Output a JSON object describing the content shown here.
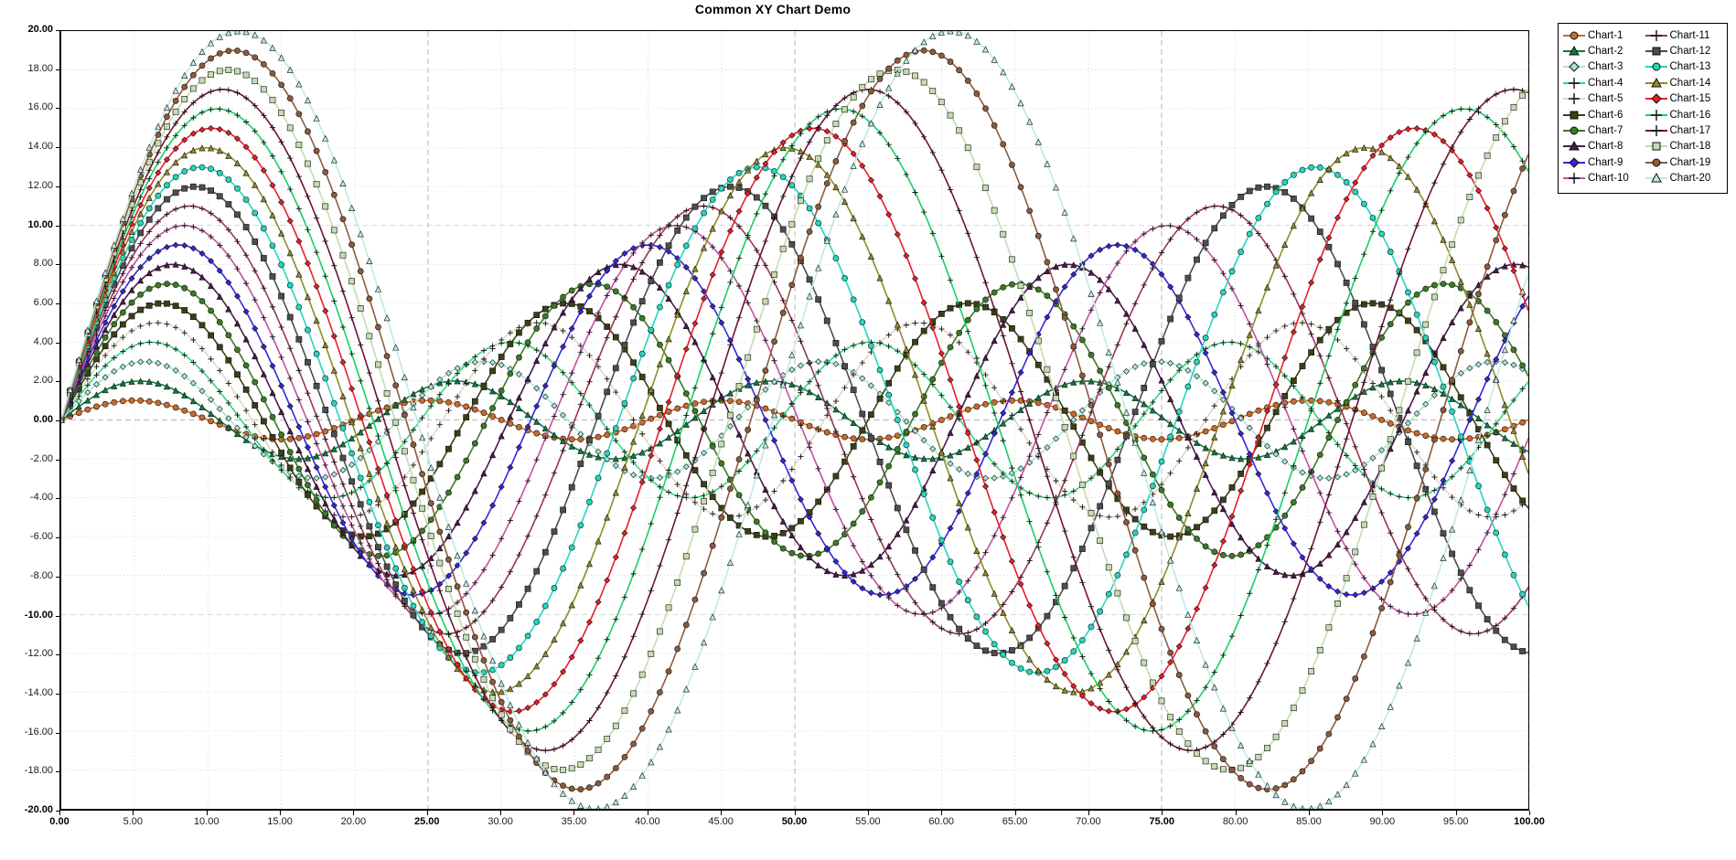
{
  "title": "Common XY Chart Demo",
  "axes": {
    "x": {
      "label": "",
      "min": 0,
      "max": 100,
      "step": 5,
      "ticks": [
        "0.00",
        "5.00",
        "10.00",
        "15.00",
        "20.00",
        "25.00",
        "30.00",
        "35.00",
        "40.00",
        "45.00",
        "50.00",
        "55.00",
        "60.00",
        "65.00",
        "70.00",
        "75.00",
        "80.00",
        "85.00",
        "90.00",
        "95.00",
        "100.00"
      ],
      "major_ticks": [
        "0.00",
        "25.00",
        "50.00",
        "75.00",
        "100.00"
      ]
    },
    "y": {
      "label": "",
      "min": -20,
      "max": 20,
      "step": 2,
      "ticks": [
        "20.00",
        "18.00",
        "16.00",
        "14.00",
        "12.00",
        "10.00",
        "8.00",
        "6.00",
        "4.00",
        "2.00",
        "0.00",
        "-2.00",
        "-4.00",
        "-6.00",
        "-8.00",
        "-10.00",
        "-12.00",
        "-14.00",
        "-16.00",
        "-18.00",
        "-20.00"
      ],
      "major_ticks": [
        "20.00",
        "10.00",
        "0.00",
        "-10.00",
        "-20.00"
      ]
    }
  },
  "grid": {
    "minor_color": "#d8d8d8",
    "major_color": "#b4b4b4",
    "minor_style": "dotted",
    "major_style": "dashed",
    "enabled": true
  },
  "legend": {
    "position": "top-right",
    "columns": 2,
    "border_color": "#000000",
    "background": "#ffffff",
    "items": [
      {
        "label": "Chart-1",
        "color": "#c96a2b",
        "marker": "circle"
      },
      {
        "label": "Chart-2",
        "color": "#117a40",
        "marker": "triangle"
      },
      {
        "label": "Chart-3",
        "color": "#a8e6d4",
        "marker": "diamond"
      },
      {
        "label": "Chart-4",
        "color": "#2fd97a",
        "marker": "plus"
      },
      {
        "label": "Chart-5",
        "color": "#ded8c8",
        "marker": "plus"
      },
      {
        "label": "Chart-6",
        "color": "#3b3f16",
        "marker": "square"
      },
      {
        "label": "Chart-7",
        "color": "#3c7a26",
        "marker": "circle"
      },
      {
        "label": "Chart-8",
        "color": "#4a1a4a",
        "marker": "triangle"
      },
      {
        "label": "Chart-9",
        "color": "#3526d6",
        "marker": "diamond"
      },
      {
        "label": "Chart-10",
        "color": "#c24fa0",
        "marker": "plus"
      },
      {
        "label": "Chart-11",
        "color": "#9b3556",
        "marker": "plus"
      },
      {
        "label": "Chart-12",
        "color": "#4d4d4d",
        "marker": "square"
      },
      {
        "label": "Chart-13",
        "color": "#24d6bd",
        "marker": "circle"
      },
      {
        "label": "Chart-14",
        "color": "#8f8a2a",
        "marker": "triangle"
      },
      {
        "label": "Chart-15",
        "color": "#e61f28",
        "marker": "diamond"
      },
      {
        "label": "Chart-16",
        "color": "#17cf63",
        "marker": "plus"
      },
      {
        "label": "Chart-17",
        "color": "#6f1433",
        "marker": "plus"
      },
      {
        "label": "Chart-18",
        "color": "#c3dcb0",
        "marker": "square"
      },
      {
        "label": "Chart-19",
        "color": "#8c5a3c",
        "marker": "circle"
      },
      {
        "label": "Chart-20",
        "color": "#bdeae0",
        "marker": "triangle"
      }
    ]
  },
  "chart_data": {
    "type": "line",
    "title": "Common XY Chart Demo",
    "xlabel": "",
    "ylabel": "",
    "xlim": [
      0,
      100
    ],
    "ylim": [
      -20,
      20
    ],
    "grid": true,
    "legend_position": "top-right",
    "x_tick_step": 5,
    "y_tick_step": 2,
    "point_count": 501,
    "description": "Twenty sinusoidal series. Series k (k=1..20) follows y = k * sin(2*pi*x / period_k) with period_k increasing with k; every series starts at y=0 for x=0. Markers are drawn densely along each curve.",
    "series": [
      {
        "name": "Chart-1",
        "amplitude": 1,
        "period": 20.0,
        "phase": 0,
        "color": "#c96a2b",
        "marker": "circle"
      },
      {
        "name": "Chart-2",
        "amplitude": 2,
        "period": 21.5,
        "phase": 0,
        "color": "#117a40",
        "marker": "triangle"
      },
      {
        "name": "Chart-3",
        "amplitude": 3,
        "period": 23.0,
        "phase": 0,
        "color": "#a8e6d4",
        "marker": "diamond"
      },
      {
        "name": "Chart-4",
        "amplitude": 4,
        "period": 24.5,
        "phase": 0,
        "color": "#2fd97a",
        "marker": "plus"
      },
      {
        "name": "Chart-5",
        "amplitude": 5,
        "period": 26.0,
        "phase": 0,
        "color": "#ded8c8",
        "marker": "plus"
      },
      {
        "name": "Chart-6",
        "amplitude": 6,
        "period": 27.5,
        "phase": 0,
        "color": "#3b3f16",
        "marker": "square"
      },
      {
        "name": "Chart-7",
        "amplitude": 7,
        "period": 29.0,
        "phase": 0,
        "color": "#3c7a26",
        "marker": "circle"
      },
      {
        "name": "Chart-8",
        "amplitude": 8,
        "period": 30.5,
        "phase": 0,
        "color": "#4a1a4a",
        "marker": "triangle"
      },
      {
        "name": "Chart-9",
        "amplitude": 9,
        "period": 32.0,
        "phase": 0,
        "color": "#3526d6",
        "marker": "diamond"
      },
      {
        "name": "Chart-10",
        "amplitude": 10,
        "period": 33.5,
        "phase": 0,
        "color": "#c24fa0",
        "marker": "plus"
      },
      {
        "name": "Chart-11",
        "amplitude": 11,
        "period": 35.0,
        "phase": 0,
        "color": "#9b3556",
        "marker": "plus"
      },
      {
        "name": "Chart-12",
        "amplitude": 12,
        "period": 36.5,
        "phase": 0,
        "color": "#4d4d4d",
        "marker": "square"
      },
      {
        "name": "Chart-13",
        "amplitude": 13,
        "period": 38.0,
        "phase": 0,
        "color": "#24d6bd",
        "marker": "circle"
      },
      {
        "name": "Chart-14",
        "amplitude": 14,
        "period": 39.5,
        "phase": 0,
        "color": "#8f8a2a",
        "marker": "triangle"
      },
      {
        "name": "Chart-15",
        "amplitude": 15,
        "period": 41.0,
        "phase": 0,
        "color": "#e61f28",
        "marker": "diamond"
      },
      {
        "name": "Chart-16",
        "amplitude": 16,
        "period": 42.5,
        "phase": 0,
        "color": "#17cf63",
        "marker": "plus"
      },
      {
        "name": "Chart-17",
        "amplitude": 17,
        "period": 44.0,
        "phase": 0,
        "color": "#6f1433",
        "marker": "plus"
      },
      {
        "name": "Chart-18",
        "amplitude": 18,
        "period": 45.5,
        "phase": 0,
        "color": "#c3dcb0",
        "marker": "square"
      },
      {
        "name": "Chart-19",
        "amplitude": 19,
        "period": 47.0,
        "phase": 0,
        "color": "#8c5a3c",
        "marker": "circle"
      },
      {
        "name": "Chart-20",
        "amplitude": 20,
        "period": 48.5,
        "phase": 0,
        "color": "#bdeae0",
        "marker": "triangle"
      }
    ]
  }
}
